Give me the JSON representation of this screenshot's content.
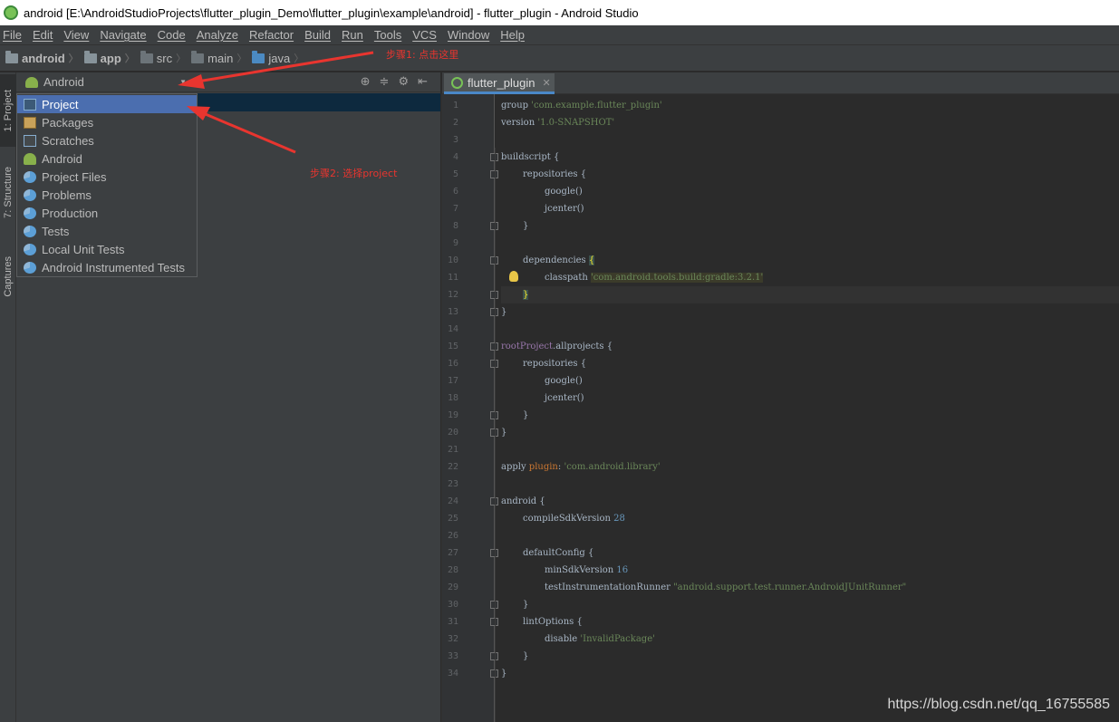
{
  "window": {
    "title": "android [E:\\AndroidStudioProjects\\flutter_plugin_Demo\\flutter_plugin\\example\\android] - flutter_plugin - Android Studio"
  },
  "menu": [
    "File",
    "Edit",
    "View",
    "Navigate",
    "Code",
    "Analyze",
    "Refactor",
    "Build",
    "Run",
    "Tools",
    "VCS",
    "Window",
    "Help"
  ],
  "breadcrumb": [
    {
      "label": "android",
      "bold": true,
      "icon": "project-folder-icon"
    },
    {
      "label": "app",
      "bold": true,
      "icon": "module-folder-icon"
    },
    {
      "label": "src",
      "bold": false,
      "icon": "folder-icon"
    },
    {
      "label": "main",
      "bold": false,
      "icon": "folder-icon"
    },
    {
      "label": "java",
      "bold": false,
      "icon": "source-folder-icon"
    }
  ],
  "annotations": {
    "step1": "步骤1: 点击这里",
    "step2": "步骤2: 选择project"
  },
  "tool_windows": {
    "project": "1: Project",
    "structure": "7: Structure",
    "captures": "Captures"
  },
  "project_panel": {
    "view_selected": "Android",
    "view_options": [
      {
        "label": "Project",
        "icon": "project-icon",
        "selected": true
      },
      {
        "label": "Packages",
        "icon": "packages-icon",
        "selected": false
      },
      {
        "label": "Scratches",
        "icon": "scratches-icon",
        "selected": false
      },
      {
        "label": "Android",
        "icon": "android-icon",
        "selected": false
      },
      {
        "label": "Project Files",
        "icon": "scope-icon",
        "selected": false
      },
      {
        "label": "Problems",
        "icon": "scope-icon",
        "selected": false
      },
      {
        "label": "Production",
        "icon": "scope-icon",
        "selected": false
      },
      {
        "label": "Tests",
        "icon": "scope-icon",
        "selected": false
      },
      {
        "label": "Local Unit Tests",
        "icon": "scope-icon",
        "selected": false
      },
      {
        "label": "Android Instrumented Tests",
        "icon": "scope-icon",
        "selected": false
      }
    ]
  },
  "editor": {
    "tab": "flutter_plugin",
    "lines": [
      {
        "no": "1",
        "indent": 0,
        "parts": [
          [
            "plain",
            "group "
          ],
          [
            "str",
            "'com.example.flutter_plugin'"
          ]
        ]
      },
      {
        "no": "2",
        "indent": 0,
        "parts": [
          [
            "plain",
            "version "
          ],
          [
            "str",
            "'1.0-SNAPSHOT'"
          ]
        ]
      },
      {
        "no": "3",
        "indent": 0,
        "parts": []
      },
      {
        "no": "4",
        "indent": 0,
        "fold": true,
        "parts": [
          [
            "plain",
            "buildscript {"
          ]
        ]
      },
      {
        "no": "5",
        "indent": 1,
        "fold": true,
        "parts": [
          [
            "plain",
            "repositories {"
          ]
        ]
      },
      {
        "no": "6",
        "indent": 2,
        "parts": [
          [
            "plain",
            "google()"
          ]
        ]
      },
      {
        "no": "7",
        "indent": 2,
        "parts": [
          [
            "plain",
            "jcenter()"
          ]
        ]
      },
      {
        "no": "8",
        "indent": 1,
        "fold": true,
        "parts": [
          [
            "plain",
            "}"
          ]
        ]
      },
      {
        "no": "9",
        "indent": 0,
        "parts": []
      },
      {
        "no": "10",
        "indent": 1,
        "fold": true,
        "parts": [
          [
            "plain",
            "dependencies "
          ],
          [
            "bracket",
            "{"
          ]
        ]
      },
      {
        "no": "11",
        "indent": 2,
        "parts": [
          [
            "plain",
            "classpath "
          ],
          [
            "hlstr",
            "'com.android.tools.build:gradle:3.2.1'"
          ]
        ]
      },
      {
        "no": "12",
        "indent": 1,
        "fold": true,
        "caret": true,
        "parts": [
          [
            "bracket",
            "}"
          ]
        ]
      },
      {
        "no": "13",
        "indent": 0,
        "fold": true,
        "parts": [
          [
            "plain",
            "}"
          ]
        ]
      },
      {
        "no": "14",
        "indent": 0,
        "parts": []
      },
      {
        "no": "15",
        "indent": 0,
        "fold": true,
        "parts": [
          [
            "purple",
            "rootProject"
          ],
          [
            "plain",
            ".allprojects {"
          ]
        ]
      },
      {
        "no": "16",
        "indent": 1,
        "fold": true,
        "parts": [
          [
            "plain",
            "repositories {"
          ]
        ]
      },
      {
        "no": "17",
        "indent": 2,
        "parts": [
          [
            "plain",
            "google()"
          ]
        ]
      },
      {
        "no": "18",
        "indent": 2,
        "parts": [
          [
            "plain",
            "jcenter()"
          ]
        ]
      },
      {
        "no": "19",
        "indent": 1,
        "fold": true,
        "parts": [
          [
            "plain",
            "}"
          ]
        ]
      },
      {
        "no": "20",
        "indent": 0,
        "fold": true,
        "parts": [
          [
            "plain",
            "}"
          ]
        ]
      },
      {
        "no": "21",
        "indent": 0,
        "parts": []
      },
      {
        "no": "22",
        "indent": 0,
        "parts": [
          [
            "plain",
            "apply "
          ],
          [
            "orange",
            "plugin"
          ],
          [
            "plain",
            ": "
          ],
          [
            "str",
            "'com.android.library'"
          ]
        ]
      },
      {
        "no": "23",
        "indent": 0,
        "parts": []
      },
      {
        "no": "24",
        "indent": 0,
        "fold": true,
        "parts": [
          [
            "plain",
            "android {"
          ]
        ]
      },
      {
        "no": "25",
        "indent": 1,
        "parts": [
          [
            "plain",
            "compileSdkVersion "
          ],
          [
            "num",
            "28"
          ]
        ]
      },
      {
        "no": "26",
        "indent": 0,
        "parts": []
      },
      {
        "no": "27",
        "indent": 1,
        "fold": true,
        "parts": [
          [
            "plain",
            "defaultConfig {"
          ]
        ]
      },
      {
        "no": "28",
        "indent": 2,
        "parts": [
          [
            "plain",
            "minSdkVersion "
          ],
          [
            "num",
            "16"
          ]
        ]
      },
      {
        "no": "29",
        "indent": 2,
        "parts": [
          [
            "plain",
            "testInstrumentationRunner "
          ],
          [
            "str",
            "\"android.support.test.runner.AndroidJUnitRunner\""
          ]
        ]
      },
      {
        "no": "30",
        "indent": 1,
        "fold": true,
        "parts": [
          [
            "plain",
            "}"
          ]
        ]
      },
      {
        "no": "31",
        "indent": 1,
        "fold": true,
        "parts": [
          [
            "plain",
            "lintOptions {"
          ]
        ]
      },
      {
        "no": "32",
        "indent": 2,
        "parts": [
          [
            "plain",
            "disable "
          ],
          [
            "str",
            "'InvalidPackage'"
          ]
        ]
      },
      {
        "no": "33",
        "indent": 1,
        "fold": true,
        "parts": [
          [
            "plain",
            "}"
          ]
        ]
      },
      {
        "no": "34",
        "indent": 0,
        "fold": true,
        "parts": [
          [
            "plain",
            "}"
          ]
        ]
      }
    ]
  },
  "watermark": "https://blog.csdn.net/qq_16755585",
  "colors": {
    "annotation": "#e8352f",
    "selection": "#4b6eaf",
    "string": "#6a8759",
    "keyword": "#cc7832",
    "number": "#6897bb"
  }
}
